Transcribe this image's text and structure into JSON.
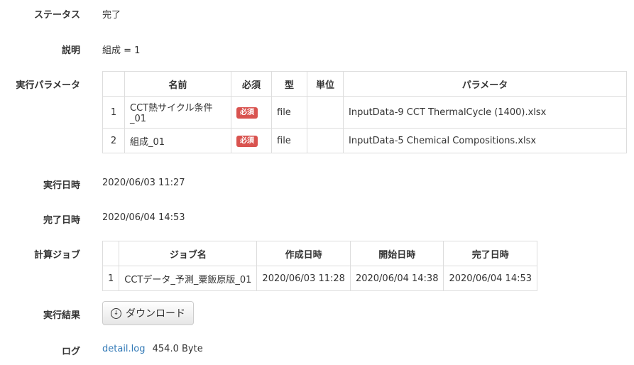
{
  "status": {
    "label": "ステータス",
    "value": "完了"
  },
  "description": {
    "label": "説明",
    "value": "組成 = 1"
  },
  "params": {
    "label": "実行パラメータ",
    "headers": [
      "",
      "名前",
      "必須",
      "型",
      "単位",
      "パラメータ"
    ],
    "rows": [
      {
        "idx": "1",
        "name": "CCT熱サイクル条件_01",
        "required": "必須",
        "type": "file",
        "unit": "",
        "param": "InputData-9 CCT ThermalCycle (1400).xlsx"
      },
      {
        "idx": "2",
        "name": "組成_01",
        "required": "必須",
        "type": "file",
        "unit": "",
        "param": "InputData-5 Chemical Compositions.xlsx"
      }
    ]
  },
  "exec_time": {
    "label": "実行日時",
    "value": "2020/06/03 11:27"
  },
  "done_time": {
    "label": "完了日時",
    "value": "2020/06/04 14:53"
  },
  "jobs": {
    "label": "計算ジョブ",
    "headers": [
      "",
      "ジョブ名",
      "作成日時",
      "開始日時",
      "完了日時"
    ],
    "rows": [
      {
        "idx": "1",
        "name": "CCTデータ_予測_粟飯原版_01",
        "created": "2020/06/03 11:28",
        "started": "2020/06/04 14:38",
        "finished": "2020/06/04 14:53"
      }
    ]
  },
  "result": {
    "label": "実行結果",
    "button": "ダウンロード",
    "icon": "download-circle-icon"
  },
  "log": {
    "label": "ログ",
    "link": "detail.log",
    "size": "454.0 Byte"
  }
}
